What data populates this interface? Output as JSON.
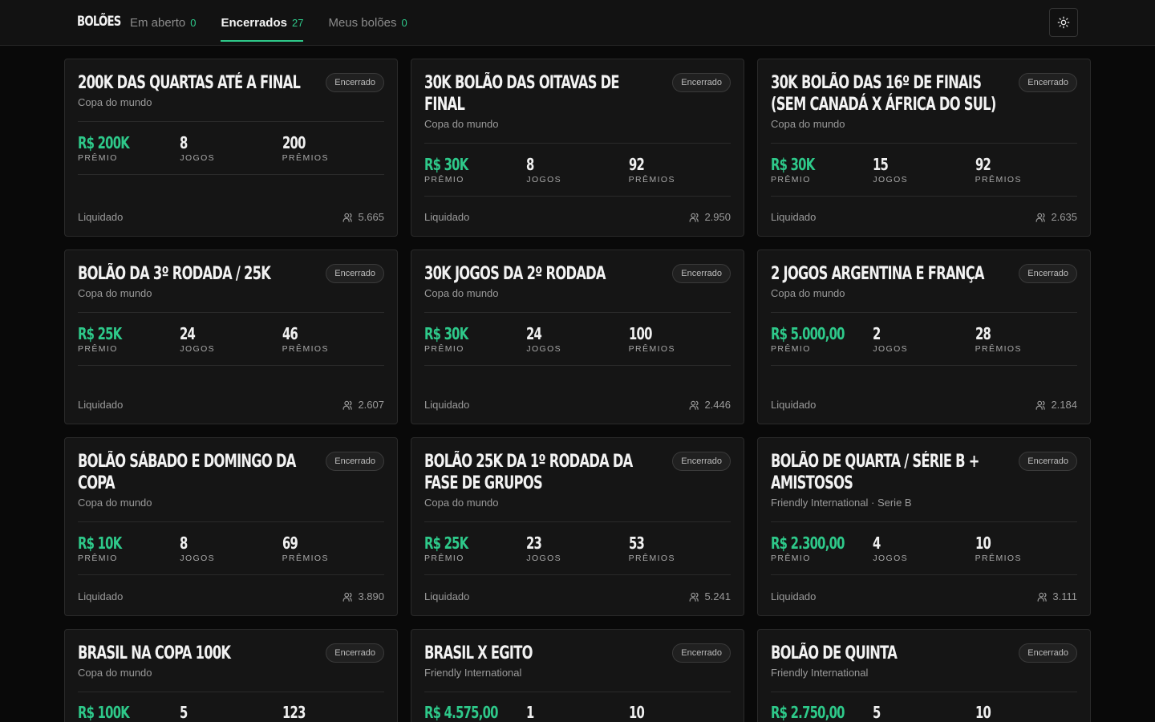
{
  "app": {
    "brand": "BOLÕES"
  },
  "tabs": [
    {
      "label": "Em aberto",
      "count": "0",
      "active": false
    },
    {
      "label": "Encerrados",
      "count": "27",
      "active": true
    },
    {
      "label": "Meus bolões",
      "count": "0",
      "active": false
    }
  ],
  "theme_toggle": {
    "icon": "sun-icon"
  },
  "labels": {
    "prize": "PRÊMIO",
    "games": "JOGOS",
    "prizes": "PRÊMIOS"
  },
  "colors": {
    "accent": "#2ec98a",
    "background": "#090909",
    "card": "#151515"
  },
  "cards": [
    {
      "title": "200K das quartas até a final",
      "badge": "Encerrado",
      "sub": "Copa do mundo",
      "prize": "R$ 200K",
      "games": "8",
      "prizes": "200",
      "status": "Liquidado",
      "participants": "5.665"
    },
    {
      "title": "30K Bolão das Oitavas de Final",
      "badge": "Encerrado",
      "sub": "Copa do mundo",
      "prize": "R$ 30K",
      "games": "8",
      "prizes": "92",
      "status": "Liquidado",
      "participants": "2.950"
    },
    {
      "title": "30K Bolão das 16º de finais (sem Canadá x África do Sul)",
      "badge": "Encerrado",
      "sub": "Copa do mundo",
      "prize": "R$ 30K",
      "games": "15",
      "prizes": "92",
      "status": "Liquidado",
      "participants": "2.635"
    },
    {
      "title": "Bolão da 3º rodada / 25K",
      "badge": "Encerrado",
      "sub": "Copa do mundo",
      "prize": "R$ 25K",
      "games": "24",
      "prizes": "46",
      "status": "Liquidado",
      "participants": "2.607"
    },
    {
      "title": "30K Jogos da 2º rodada",
      "badge": "Encerrado",
      "sub": "Copa do mundo",
      "prize": "R$ 30K",
      "games": "24",
      "prizes": "100",
      "status": "Liquidado",
      "participants": "2.446"
    },
    {
      "title": "2 Jogos Argentina e França",
      "badge": "Encerrado",
      "sub": "Copa do mundo",
      "prize": "R$ 5.000,00",
      "games": "2",
      "prizes": "28",
      "status": "Liquidado",
      "participants": "2.184"
    },
    {
      "title": "Bolão Sábado e domingo da copa",
      "badge": "Encerrado",
      "sub": "Copa do mundo",
      "prize": "R$ 10K",
      "games": "8",
      "prizes": "69",
      "status": "Liquidado",
      "participants": "3.890"
    },
    {
      "title": "Bolão 25K da 1º rodada da fase de grupos",
      "badge": "Encerrado",
      "sub": "Copa do mundo",
      "prize": "R$ 25K",
      "games": "23",
      "prizes": "53",
      "status": "Liquidado",
      "participants": "5.241"
    },
    {
      "title": "Bolão de quarta / Série B + Amistosos",
      "badge": "Encerrado",
      "sub": "Friendly International · Serie B",
      "prize": "R$ 2.300,00",
      "games": "4",
      "prizes": "10",
      "status": "Liquidado",
      "participants": "3.111"
    },
    {
      "title": "Brasil na Copa 100K",
      "badge": "Encerrado",
      "sub": "Copa do mundo",
      "prize": "R$ 100K",
      "games": "5",
      "prizes": "123",
      "status": "",
      "participants": ""
    },
    {
      "title": "Brasil x Egito",
      "badge": "Encerrado",
      "sub": "Friendly International",
      "prize": "R$ 4.575,00",
      "games": "1",
      "prizes": "10",
      "status": "",
      "participants": ""
    },
    {
      "title": "Bolão de Quinta",
      "badge": "Encerrado",
      "sub": "Friendly International",
      "prize": "R$ 2.750,00",
      "games": "5",
      "prizes": "10",
      "status": "",
      "participants": ""
    }
  ]
}
